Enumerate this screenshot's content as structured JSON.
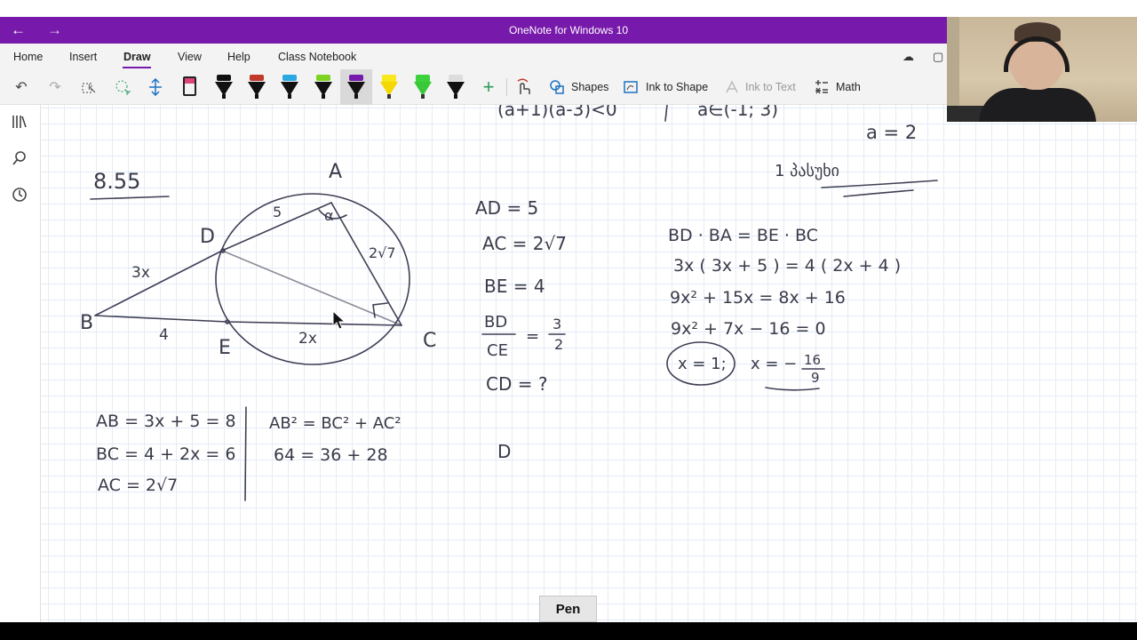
{
  "window": {
    "title": "OneNote for Windows 10",
    "back_glyph": "←",
    "forward_glyph": "→"
  },
  "menu": {
    "tabs": [
      "Home",
      "Insert",
      "Draw",
      "View",
      "Help",
      "Class Notebook"
    ],
    "active_tab": "Draw"
  },
  "toolbar": {
    "undo_glyph": "↶",
    "redo_glyph": "↷",
    "add_pen_glyph": "+",
    "shapes_label": "Shapes",
    "ink_to_shape_label": "Ink to Shape",
    "ink_to_text_label": "Ink to Text",
    "math_label": "Math",
    "pen_colors": [
      "#111111",
      "#c0392b",
      "#29a9e0",
      "#7ed321",
      "#7719aa",
      "#f8e71c",
      "#3dd13d",
      "#222222"
    ]
  },
  "tooltip": {
    "text": "Pen"
  },
  "notes": {
    "problem_number": "8.55",
    "top_fragment_left": "(a+1)(a-3)<0",
    "top_fragment_mid": "a∈(-1; 3)",
    "a_value": "a = 2",
    "answer_line": "1 პასუხი",
    "points": {
      "A": "A",
      "B": "B",
      "C": "C",
      "D": "D",
      "E": "E"
    },
    "segment_labels": {
      "ad": "5",
      "bd": "3x",
      "be": "4",
      "ec": "2x",
      "ac": "2√7",
      "alpha": "α"
    },
    "givens": [
      "AD = 5",
      "AC = 2√7",
      "BE = 4"
    ],
    "ratio": {
      "num": "BD",
      "den": "CE",
      "value_num": "3",
      "value_den": "2"
    },
    "question": "CD = ?",
    "equations": [
      "BD · BA = BE · BC",
      "3x ( 3x + 5 ) = 4 ( 2x + 4 )",
      "9x² + 15x = 8x + 16",
      "9x² + 7x − 16 = 0"
    ],
    "root1": "x = 1;",
    "root2_prefix": "x = −",
    "root2_num": "16",
    "root2_den": "9",
    "left_calc": [
      "AB = 3x + 5 = 8",
      "BC = 4 + 2x = 6",
      "AC = 2√7"
    ],
    "pythag": [
      "AB² = BC² + AC²",
      "64 = 36 + 28"
    ],
    "stray": "D"
  }
}
